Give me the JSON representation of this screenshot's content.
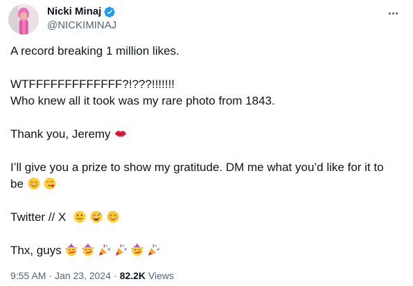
{
  "author": {
    "display_name": "Nicki Minaj",
    "handle": "@NICKIMINAJ"
  },
  "tweet": {
    "line1": "A record breaking 1 million likes.",
    "line2": "WTFFFFFFFFFFFFF?!???!!!!!!!",
    "line3": "Who knew all it took was my rare photo from 1843.",
    "line4": "Thank you, Jeremy",
    "line5": "I’ll give you a prize to show my gratitude. DM me what you’d like for it to",
    "line6": "be",
    "line7": "Twitter // X",
    "line8": "Thx, guys"
  },
  "meta": {
    "time": "9:55 AM",
    "date": "Jan 23, 2024",
    "views_count": "82.2K",
    "views_label": "Views",
    "separator": "·"
  },
  "icons": {
    "verified": "verified-badge-icon",
    "more": "more-options-icon",
    "lips": "kiss-lips-emoji",
    "blush": "smiling-blush-emoji",
    "kiss": "blowing-kiss-emoji",
    "slight_smile": "slightly-smiling-emoji",
    "sweat_smile": "sweat-smile-emoji",
    "party_face": "partying-face-emoji",
    "popper": "party-popper-emoji"
  },
  "colors": {
    "text": "#0f1419",
    "secondary": "#536471",
    "verified": "#1d9bf0"
  }
}
